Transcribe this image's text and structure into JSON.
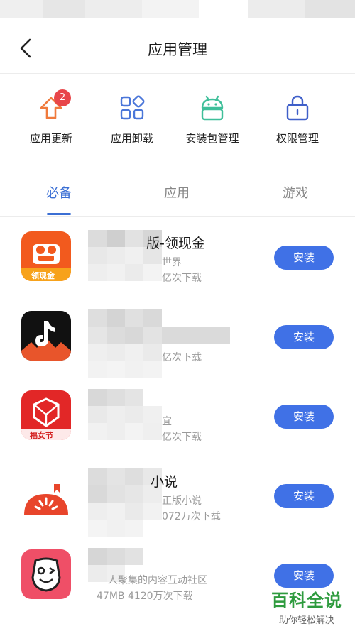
{
  "header": {
    "title": "应用管理"
  },
  "quick_actions": [
    {
      "label": "应用更新",
      "badge": "2",
      "icon": "upload-arrow-icon"
    },
    {
      "label": "应用卸载",
      "icon": "grid-icon"
    },
    {
      "label": "安装包管理",
      "icon": "android-icon"
    },
    {
      "label": "权限管理",
      "icon": "lock-icon"
    }
  ],
  "tabs": [
    {
      "label": "必备",
      "active": true
    },
    {
      "label": "应用",
      "active": false
    },
    {
      "label": "游戏",
      "active": false
    }
  ],
  "apps": [
    {
      "name": "版-领现金",
      "desc": "世界",
      "meta": "亿次下载",
      "icon_text": "领现金",
      "install_label": "安装"
    },
    {
      "name": "",
      "desc": "",
      "meta": "亿次下载",
      "install_label": "安装"
    },
    {
      "name": "",
      "desc": "宜",
      "meta": "亿次下载",
      "icon_text": "福女节",
      "install_label": "安装"
    },
    {
      "name": "小说",
      "desc": "正版小说",
      "meta": "072万次下载",
      "install_label": "安装"
    },
    {
      "name": "",
      "desc": "人聚集的内容互动社区",
      "meta": "47MB  4120万次下载",
      "install_label": "安装"
    }
  ],
  "watermark": {
    "title": "百科全说",
    "subtitle": "助你轻松解决"
  },
  "colors": {
    "accent": "#4071e6",
    "tab_active": "#3b6fd4",
    "badge": "#e8464a"
  }
}
